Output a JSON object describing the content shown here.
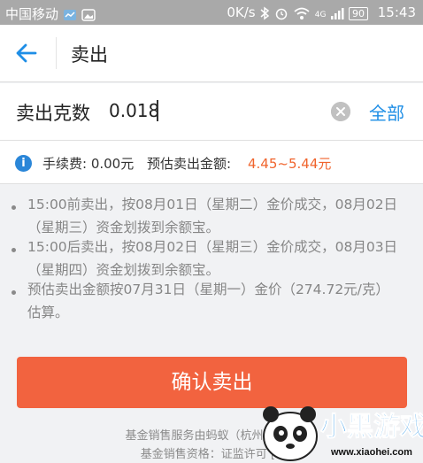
{
  "status_bar": {
    "carrier": "中国移动",
    "speed": "0K/s",
    "network": "4G",
    "battery": "90",
    "time": "15:43"
  },
  "header": {
    "title": "卖出"
  },
  "amount": {
    "label": "卖出克数",
    "value": "0.018",
    "all_label": "全部"
  },
  "fee": {
    "fee_text": "手续费: 0.00元",
    "estimate_label": "预估卖出金额:",
    "estimate_range": "4.45~5.44元"
  },
  "notes": [
    {
      "line1": "15:00前卖出，按08月01日（星期二）金价成交，08月02日",
      "line2": "（星期三）资金划拨到余额宝。"
    },
    {
      "line1": "15:00后卖出，按08月02日（星期三）金价成交，08月03日",
      "line2": "（星期四）资金划拨到余额宝。"
    },
    {
      "line1": "预估卖出金额按07月31日（星期一）金价（274.72元/克）",
      "line2": "估算。"
    }
  ],
  "confirm_label": "确认卖出",
  "footer": {
    "line1": "基金销售服务由蚂蚁（杭州）基金",
    "line2": "基金销售资格：证监许可 [2"
  },
  "watermark": {
    "brand": "小黑游戏",
    "url": "www.xiaohei.com"
  },
  "colors": {
    "accent": "#1e8ee6",
    "primary_button": "#f2633f",
    "estimate": "#f0642d"
  }
}
